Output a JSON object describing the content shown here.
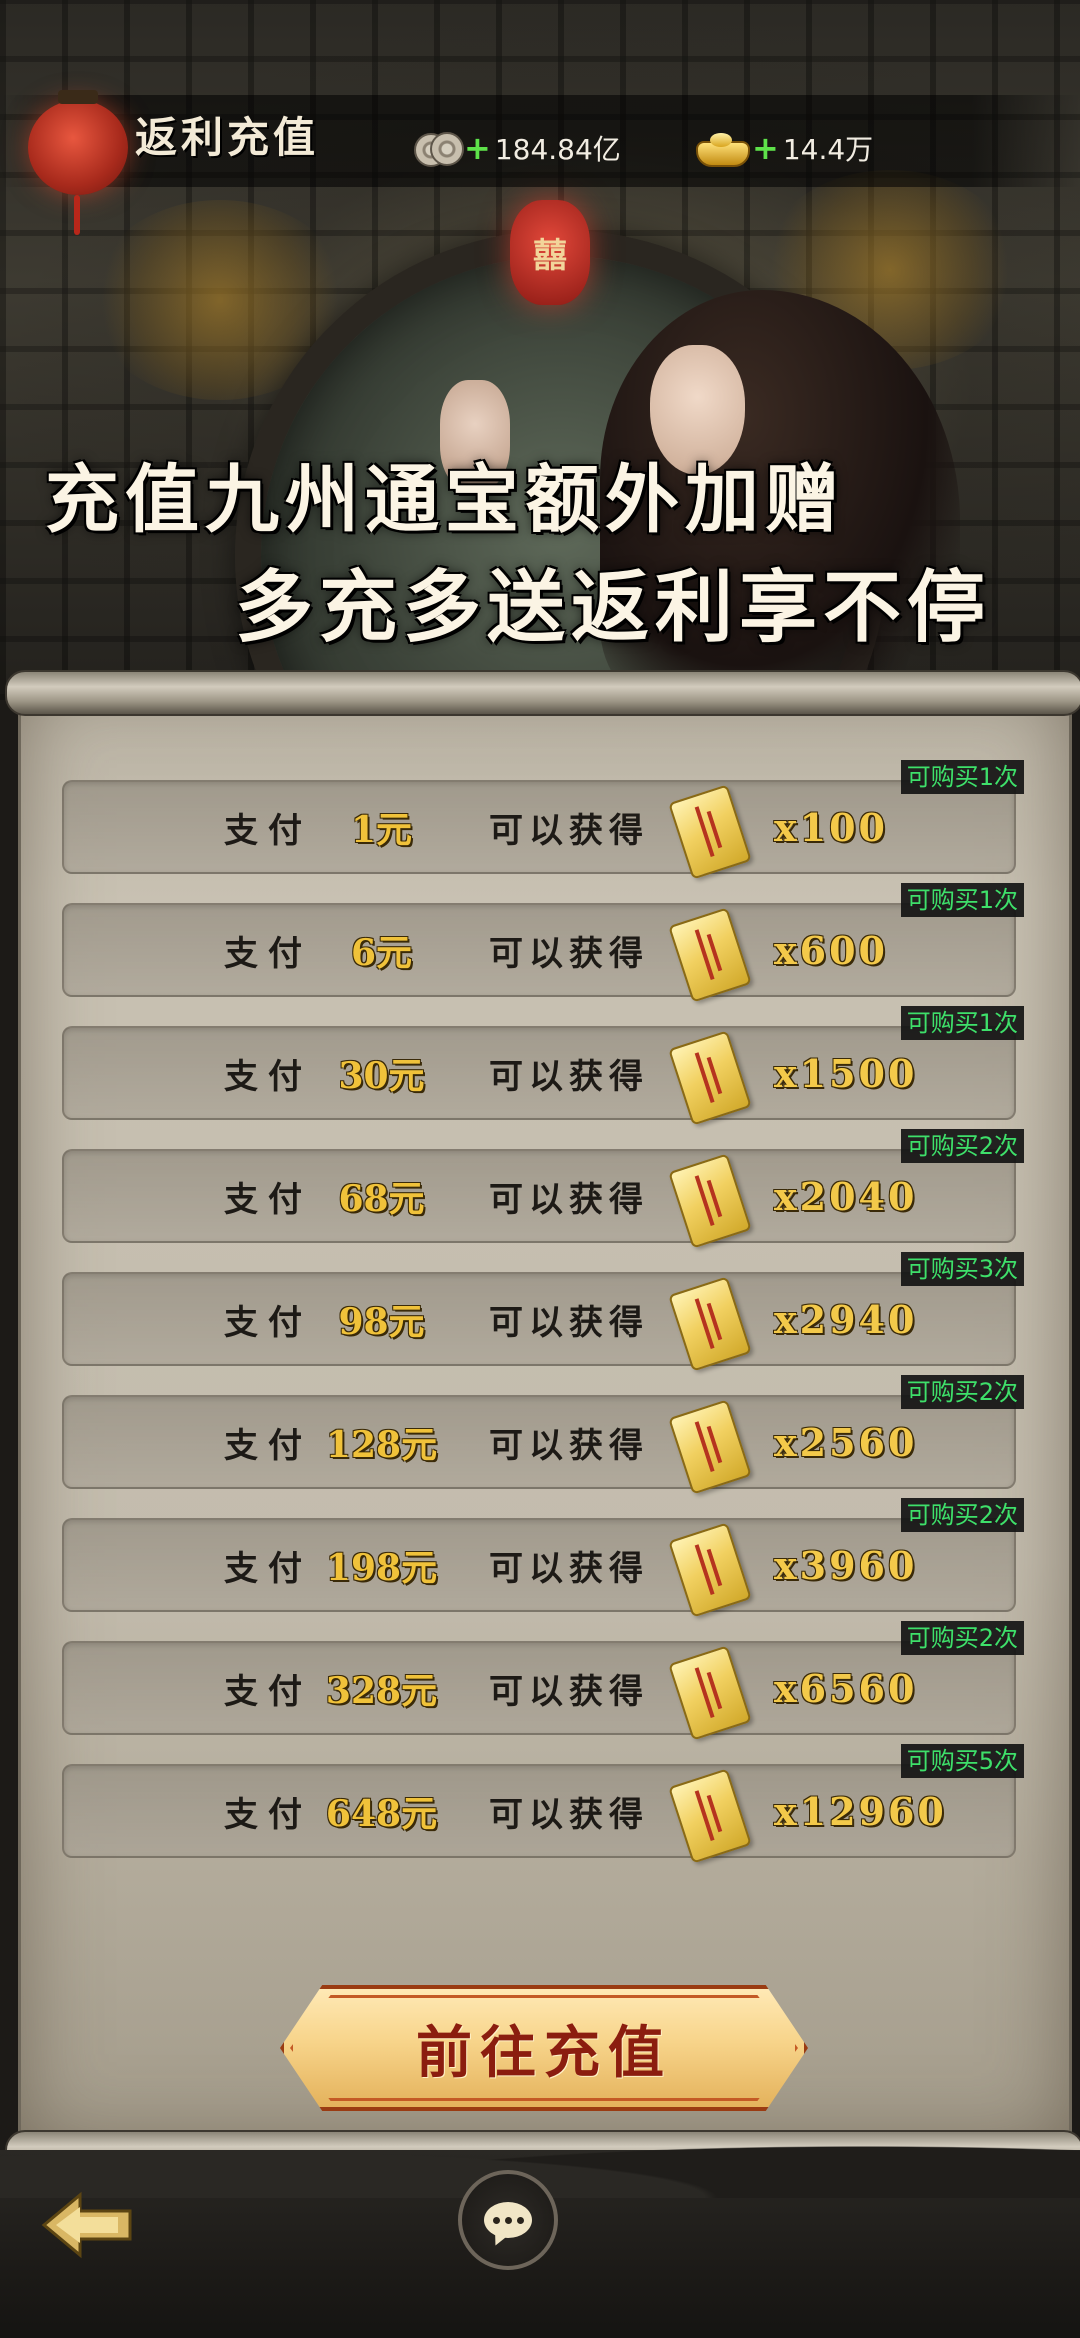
{
  "header": {
    "title": "返利充值",
    "currencies": [
      {
        "icon": "copper-coins-icon",
        "value": "184.84亿"
      },
      {
        "icon": "gold-ingot-icon",
        "value": "14.4万"
      }
    ]
  },
  "banner": {
    "line1": "充值九州通宝额外加赠",
    "line2": "多充多送返利享不停"
  },
  "offers": [
    {
      "pay": "支付",
      "price": "1元",
      "get": "可以获得",
      "quantity": "x100",
      "limit": "可购买1次"
    },
    {
      "pay": "支付",
      "price": "6元",
      "get": "可以获得",
      "quantity": "x600",
      "limit": "可购买1次"
    },
    {
      "pay": "支付",
      "price": "30元",
      "get": "可以获得",
      "quantity": "x1500",
      "limit": "可购买1次"
    },
    {
      "pay": "支付",
      "price": "68元",
      "get": "可以获得",
      "quantity": "x2040",
      "limit": "可购买2次"
    },
    {
      "pay": "支付",
      "price": "98元",
      "get": "可以获得",
      "quantity": "x2940",
      "limit": "可购买3次"
    },
    {
      "pay": "支付",
      "price": "128元",
      "get": "可以获得",
      "quantity": "x2560",
      "limit": "可购买2次"
    },
    {
      "pay": "支付",
      "price": "198元",
      "get": "可以获得",
      "quantity": "x3960",
      "limit": "可购买2次"
    },
    {
      "pay": "支付",
      "price": "328元",
      "get": "可以获得",
      "quantity": "x6560",
      "limit": "可购买2次"
    },
    {
      "pay": "支付",
      "price": "648元",
      "get": "可以获得",
      "quantity": "x12960",
      "limit": "可购买5次"
    }
  ],
  "actions": {
    "recharge_label": "前往充值"
  },
  "colors": {
    "limit_text": "#3ee06a",
    "price_gold": "#f0c23a",
    "button_text": "#8b1d0f"
  }
}
